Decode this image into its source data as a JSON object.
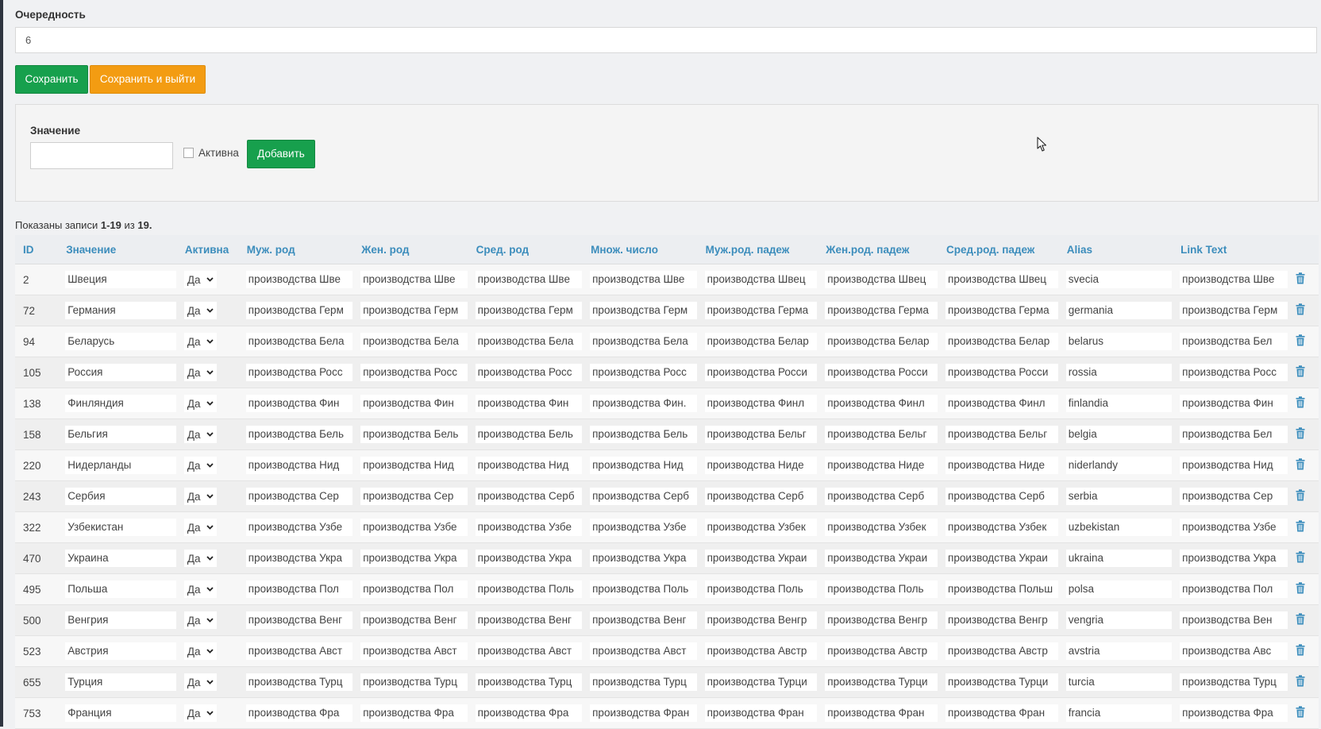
{
  "form": {
    "order_label": "Очередность",
    "order_value": "6",
    "save_label": "Сохранить",
    "save_exit_label": "Сохранить и выйти"
  },
  "add": {
    "value_label": "Значение",
    "value_input": "",
    "active_label": "Активна",
    "add_label": "Добавить"
  },
  "summary": {
    "prefix": "Показаны записи",
    "range": "1-19",
    "of": "из",
    "total": "19."
  },
  "columns": [
    "ID",
    "Значение",
    "Активна",
    "Муж. род",
    "Жен. род",
    "Сред. род",
    "Множ. число",
    "Муж.род. падеж",
    "Жен.род. падеж",
    "Сред.род. падеж",
    "Alias",
    "Link Text"
  ],
  "rows": [
    {
      "id": "2",
      "value": "Швеция",
      "active": "Да",
      "alias": "svecia",
      "m": "производства Шве",
      "f": "производства Шве",
      "n": "производства Шве",
      "pl": "производства Шве",
      "mg": "производства Швец",
      "fg": "производства Швец",
      "ng": "производства Швец",
      "link": "производства Шве"
    },
    {
      "id": "72",
      "value": "Германия",
      "active": "Да",
      "alias": "germania",
      "m": "производства Герм",
      "f": "производства Герм",
      "n": "производства Герм",
      "pl": "производства Герм",
      "mg": "производства Герма",
      "fg": "производства Герма",
      "ng": "производства Герма",
      "link": "производства Герм"
    },
    {
      "id": "94",
      "value": "Беларусь",
      "active": "Да",
      "alias": "belarus",
      "m": "производства Бела",
      "f": "производства Бела",
      "n": "производства Бела",
      "pl": "производства Бела",
      "mg": "производства Белар",
      "fg": "производства Белар",
      "ng": "производства Белар",
      "link": "производства Бел"
    },
    {
      "id": "105",
      "value": "Россия",
      "active": "Да",
      "alias": "rossia",
      "m": "производства Росс",
      "f": "производства Росс",
      "n": "производства Росс",
      "pl": "производства Росс",
      "mg": "производства Росси",
      "fg": "производства Росси",
      "ng": "производства Росси",
      "link": "производства Росс"
    },
    {
      "id": "138",
      "value": "Финляндия",
      "active": "Да",
      "alias": "finlandia",
      "m": "производства Фин",
      "f": "производства Фин",
      "n": "производства Фин",
      "pl": "производства Фин.",
      "mg": "производства Финл",
      "fg": "производства Финл",
      "ng": "производства Финл",
      "link": "производства Фин"
    },
    {
      "id": "158",
      "value": "Бельгия",
      "active": "Да",
      "alias": "belgia",
      "m": "производства Бель",
      "f": "производства Бель",
      "n": "производства Бель",
      "pl": "производства Бель",
      "mg": "производства Бельг",
      "fg": "производства Бельг",
      "ng": "производства Бельг",
      "link": "производства Бел"
    },
    {
      "id": "220",
      "value": "Нидерланды",
      "active": "Да",
      "alias": "niderlandy",
      "m": "производства Нид",
      "f": "производства Нид",
      "n": "производства Нид",
      "pl": "производства Нид",
      "mg": "производства Ниде",
      "fg": "производства Ниде",
      "ng": "производства Ниде",
      "link": "производства Нид"
    },
    {
      "id": "243",
      "value": "Сербия",
      "active": "Да",
      "alias": "serbia",
      "m": "производства Сер",
      "f": "производства Сер",
      "n": "производства Серб",
      "pl": "производства Серб",
      "mg": "производства Серб",
      "fg": "производства Серб",
      "ng": "производства Серб",
      "link": "производства Сер"
    },
    {
      "id": "322",
      "value": "Узбекистан",
      "active": "Да",
      "alias": "uzbekistan",
      "m": "производства Узбе",
      "f": "производства Узбе",
      "n": "производства Узбе",
      "pl": "производства Узбе",
      "mg": "производства Узбек",
      "fg": "производства Узбек",
      "ng": "производства Узбек",
      "link": "производства Узбе"
    },
    {
      "id": "470",
      "value": "Украина",
      "active": "Да",
      "alias": "ukraina",
      "m": "производства Укра",
      "f": "производства Укра",
      "n": "производства Укра",
      "pl": "производства Укра",
      "mg": "производства Украи",
      "fg": "производства Украи",
      "ng": "производства Украи",
      "link": "производства Укра"
    },
    {
      "id": "495",
      "value": "Польша",
      "active": "Да",
      "alias": "polsa",
      "m": "производства Пол",
      "f": "производства Пол",
      "n": "производства Поль",
      "pl": "производства Поль",
      "mg": "производства Поль",
      "fg": "производства Поль",
      "ng": "производства Польш",
      "link": "производства Пол"
    },
    {
      "id": "500",
      "value": "Венгрия",
      "active": "Да",
      "alias": "vengria",
      "m": "производства Венг",
      "f": "производства Венг",
      "n": "производства Венг",
      "pl": "производства Венг",
      "mg": "производства Венгр",
      "fg": "производства Венгр",
      "ng": "производства Венгр",
      "link": "производства Вен"
    },
    {
      "id": "523",
      "value": "Австрия",
      "active": "Да",
      "alias": "avstria",
      "m": "производства Авст",
      "f": "производства Авст",
      "n": "производства Авст",
      "pl": "производства Авст",
      "mg": "производства Австр",
      "fg": "производства Австр",
      "ng": "производства Австр",
      "link": "производства Авс"
    },
    {
      "id": "655",
      "value": "Турция",
      "active": "Да",
      "alias": "turcia",
      "m": "производства Турц",
      "f": "производства Турц",
      "n": "производства Турц",
      "pl": "производства Турц",
      "mg": "производства Турци",
      "fg": "производства Турци",
      "ng": "производства Турци",
      "link": "производства Турц"
    },
    {
      "id": "753",
      "value": "Франция",
      "active": "Да",
      "alias": "francia",
      "m": "производства Фра",
      "f": "производства Фра",
      "n": "производства Фра",
      "pl": "производства Фран",
      "mg": "производства Фран",
      "fg": "производства Фран",
      "ng": "производства Фран",
      "link": "производства Фра"
    }
  ],
  "colors": {
    "primary_green": "#17a04d",
    "orange": "#f39c12",
    "link_blue": "#3c8dbc",
    "trash_blue": "#3c8dbc"
  },
  "icons": {
    "delete": "trash-icon",
    "dropdown": "chevron-down-icon",
    "pointer": "mouse-cursor-icon"
  }
}
